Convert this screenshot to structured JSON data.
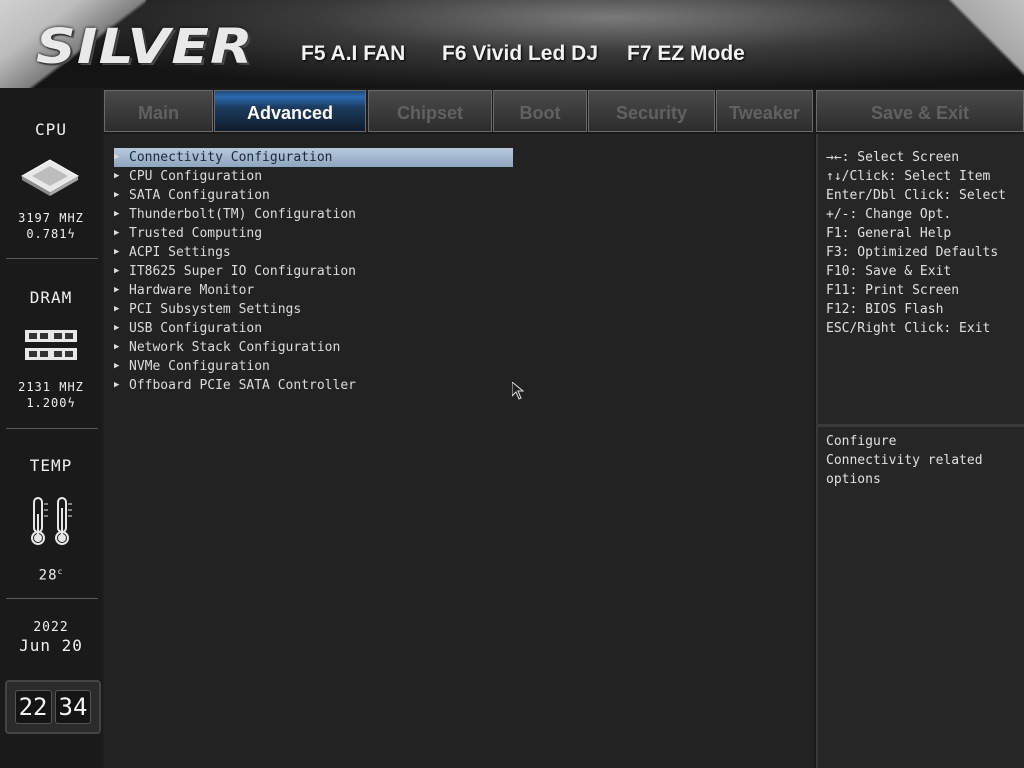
{
  "banner": {
    "logo": "SILVER",
    "hotkeys": [
      "F5 A.I FAN",
      "F6 Vivid Led DJ",
      "F7 EZ Mode"
    ]
  },
  "left_panel": {
    "cpu": {
      "title": "CPU",
      "freq": "3197 MHZ",
      "voltage": "0.781",
      "icon": "cpu-chip-icon"
    },
    "dram": {
      "title": "DRAM",
      "freq": "2131 MHZ",
      "voltage": "1.200",
      "icon": "memory-module-icon"
    },
    "temp": {
      "title": "TEMP",
      "value": "28",
      "unit": "c",
      "icon": "thermometer-icon"
    },
    "date": {
      "year": "2022",
      "month": "Jun",
      "day": "20"
    },
    "clock": {
      "hours": "22",
      "minutes": "34"
    }
  },
  "tabs": [
    {
      "label": "Main",
      "active": false
    },
    {
      "label": "Advanced",
      "active": true
    },
    {
      "label": "Chipset",
      "active": false
    },
    {
      "label": "Boot",
      "active": false
    },
    {
      "label": "Security",
      "active": false
    },
    {
      "label": "Tweaker",
      "active": false
    },
    {
      "label": "Save & Exit",
      "active": false
    }
  ],
  "menu": {
    "selected_index": 0,
    "items": [
      "Connectivity Configuration",
      "CPU Configuration",
      "SATA Configuration",
      "Thunderbolt(TM) Configuration",
      "Trusted Computing",
      "ACPI Settings",
      "IT8625 Super IO Configuration",
      "Hardware Monitor",
      "PCI Subsystem Settings",
      "USB Configuration",
      "Network Stack Configuration",
      "NVMe Configuration",
      "Offboard PCIe SATA Controller"
    ]
  },
  "help": {
    "keys": [
      "→←: Select Screen",
      "↑↓/Click: Select Item",
      "Enter/Dbl Click: Select",
      "+/-: Change Opt.",
      "F1: General Help",
      "F3: Optimized Defaults",
      "F10: Save & Exit",
      "F11: Print Screen",
      "F12: BIOS Flash",
      "ESC/Right Click: Exit"
    ],
    "description": [
      "Configure",
      "Connectivity related",
      "options"
    ]
  }
}
